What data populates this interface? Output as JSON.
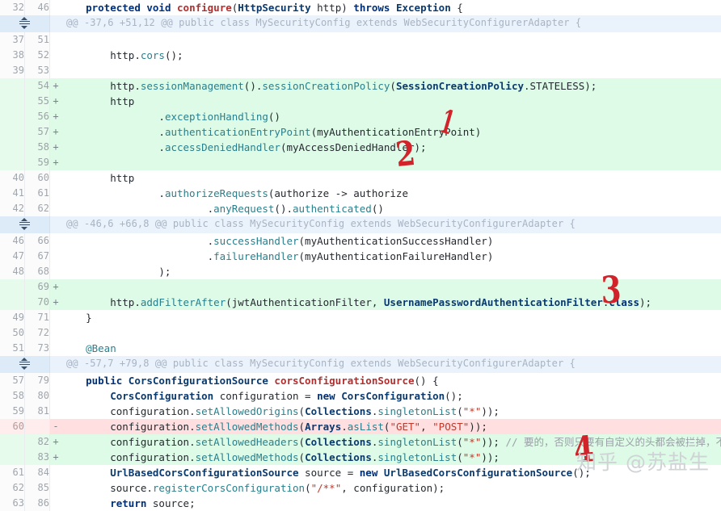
{
  "watermark": "知乎 @苏盐生",
  "annotations": [
    {
      "id": "annot-1",
      "label": "1"
    },
    {
      "id": "annot-2",
      "label": "2"
    },
    {
      "id": "annot-3",
      "label": "3"
    },
    {
      "id": "annot-4",
      "label": "4"
    }
  ],
  "icons": {
    "unfold": "unfold-icon"
  },
  "rows": [
    {
      "type": "ctx",
      "old": "32",
      "new": "46",
      "marker": "",
      "code": "    <span class=\"kw\">protected</span> <span class=\"kw\">void</span> <span class=\"fn\">configure</span>(<span class=\"typ\">HttpSecurity</span> <span class=\"pln\">http</span>) <span class=\"kw\">throws</span> <span class=\"typ\">Exception</span> {"
    },
    {
      "type": "hunk",
      "old": "",
      "new": "",
      "marker": "",
      "code": "@@ -37,6 +51,12 @@ public class MySecurityConfig extends WebSecurityConfigurerAdapter {"
    },
    {
      "type": "ctx",
      "old": "37",
      "new": "51",
      "marker": "",
      "code": ""
    },
    {
      "type": "ctx",
      "old": "38",
      "new": "52",
      "marker": "",
      "code": "        <span class=\"pln\">http</span>.<span class=\"mth\">cors</span>();"
    },
    {
      "type": "ctx",
      "old": "39",
      "new": "53",
      "marker": "",
      "code": ""
    },
    {
      "type": "add",
      "old": "",
      "new": "54",
      "marker": "+",
      "code": "        <span class=\"pln\">http</span>.<span class=\"mth\">sessionManagement</span>().<span class=\"mth\">sessionCreationPolicy</span>(<span class=\"typ\">SessionCreationPolicy</span>.<span class=\"pln\">STATELESS</span>);"
    },
    {
      "type": "add",
      "old": "",
      "new": "55",
      "marker": "+",
      "code": "        <span class=\"pln\">http</span>"
    },
    {
      "type": "add",
      "old": "",
      "new": "56",
      "marker": "+",
      "code": "                .<span class=\"mth\">exceptionHandling</span>()"
    },
    {
      "type": "add",
      "old": "",
      "new": "57",
      "marker": "+",
      "code": "                .<span class=\"mth\">authenticationEntryPoint</span>(<span class=\"pln\">myAuthenticationEntryPoint</span>)"
    },
    {
      "type": "add",
      "old": "",
      "new": "58",
      "marker": "+",
      "code": "                .<span class=\"mth\">accessDeniedHandler</span>(<span class=\"pln\">myAccessDeniedHandler</span>);"
    },
    {
      "type": "add",
      "old": "",
      "new": "59",
      "marker": "+",
      "code": ""
    },
    {
      "type": "ctx",
      "old": "40",
      "new": "60",
      "marker": "",
      "code": "        <span class=\"pln\">http</span>"
    },
    {
      "type": "ctx",
      "old": "41",
      "new": "61",
      "marker": "",
      "code": "                .<span class=\"mth\">authorizeRequests</span>(<span class=\"pln\">authorize</span> -&gt; <span class=\"pln\">authorize</span>"
    },
    {
      "type": "ctx",
      "old": "42",
      "new": "62",
      "marker": "",
      "code": "                        .<span class=\"mth\">anyRequest</span>().<span class=\"mth\">authenticated</span>()"
    },
    {
      "type": "hunk",
      "old": "",
      "new": "",
      "marker": "",
      "code": "@@ -46,6 +66,8 @@ public class MySecurityConfig extends WebSecurityConfigurerAdapter {"
    },
    {
      "type": "ctx",
      "old": "46",
      "new": "66",
      "marker": "",
      "code": "                        .<span class=\"mth\">successHandler</span>(<span class=\"pln\">myAuthenticationSuccessHandler</span>)"
    },
    {
      "type": "ctx",
      "old": "47",
      "new": "67",
      "marker": "",
      "code": "                        .<span class=\"mth\">failureHandler</span>(<span class=\"pln\">myAuthenticationFailureHandler</span>)"
    },
    {
      "type": "ctx",
      "old": "48",
      "new": "68",
      "marker": "",
      "code": "                );"
    },
    {
      "type": "add",
      "old": "",
      "new": "69",
      "marker": "+",
      "code": ""
    },
    {
      "type": "add",
      "old": "",
      "new": "70",
      "marker": "+",
      "code": "        <span class=\"pln\">http</span>.<span class=\"mth\">addFilterAfter</span>(<span class=\"pln\">jwtAuthenticationFilter</span>, <span class=\"typ\">UsernamePasswordAuthenticationFilter</span>.<span class=\"kw\">class</span>);"
    },
    {
      "type": "ctx",
      "old": "49",
      "new": "71",
      "marker": "",
      "code": "    }"
    },
    {
      "type": "ctx",
      "old": "50",
      "new": "72",
      "marker": "",
      "code": ""
    },
    {
      "type": "ctx",
      "old": "51",
      "new": "73",
      "marker": "",
      "code": "    <span class=\"mth\">@Bean</span>"
    },
    {
      "type": "hunk",
      "old": "",
      "new": "",
      "marker": "",
      "code": "@@ -57,7 +79,8 @@ public class MySecurityConfig extends WebSecurityConfigurerAdapter {"
    },
    {
      "type": "ctx",
      "old": "57",
      "new": "79",
      "marker": "",
      "code": "    <span class=\"kw\">public</span> <span class=\"typ\">CorsConfigurationSource</span> <span class=\"fn\">corsConfigurationSource</span>() {"
    },
    {
      "type": "ctx",
      "old": "58",
      "new": "80",
      "marker": "",
      "code": "        <span class=\"typ\">CorsConfiguration</span> <span class=\"pln\">configuration</span> = <span class=\"kw\">new</span> <span class=\"typ\">CorsConfiguration</span>();"
    },
    {
      "type": "ctx",
      "old": "59",
      "new": "81",
      "marker": "",
      "code": "        <span class=\"pln\">configuration</span>.<span class=\"mth\">setAllowedOrigins</span>(<span class=\"typ\">Collections</span>.<span class=\"mth\">singletonList</span>(<span class=\"str\">\"*\"</span>));"
    },
    {
      "type": "del",
      "old": "60",
      "new": "",
      "marker": "-",
      "code": "        <span class=\"pln\">configuration</span>.<span class=\"mth\">setAllowedMethods</span>(<span class=\"typ\">Arrays</span>.<span class=\"mth\">asList</span>(<span class=\"str\">\"GET\"</span>, <span class=\"str\">\"POST\"</span>));"
    },
    {
      "type": "add",
      "old": "",
      "new": "82",
      "marker": "+",
      "code": "        <span class=\"pln\">configuration</span>.<span class=\"mth\">setAllowedHeaders</span>(<span class=\"typ\">Collections</span>.<span class=\"mth\">singletonList</span>(<span class=\"str\">\"*\"</span>)); <span class=\"cmt\">// 要的，否则只要有自定义的头都会被拦掉，不允许跨域</span>"
    },
    {
      "type": "add",
      "old": "",
      "new": "83",
      "marker": "+",
      "code": "        <span class=\"pln\">configuration</span>.<span class=\"mth\">setAllowedMethods</span>(<span class=\"typ\">Collections</span>.<span class=\"mth\">singletonList</span>(<span class=\"str\">\"*\"</span>));"
    },
    {
      "type": "ctx",
      "old": "61",
      "new": "84",
      "marker": "",
      "code": "        <span class=\"typ\">UrlBasedCorsConfigurationSource</span> <span class=\"pln\">source</span> = <span class=\"kw\">new</span> <span class=\"typ\">UrlBasedCorsConfigurationSource</span>();"
    },
    {
      "type": "ctx",
      "old": "62",
      "new": "85",
      "marker": "",
      "code": "        <span class=\"pln\">source</span>.<span class=\"mth\">registerCorsConfiguration</span>(<span class=\"str\">\"/**\"</span>, <span class=\"pln\">configuration</span>);"
    },
    {
      "type": "ctx",
      "old": "63",
      "new": "86",
      "marker": "",
      "code": "        <span class=\"kw\">return</span> <span class=\"pln\">source</span>;"
    }
  ]
}
